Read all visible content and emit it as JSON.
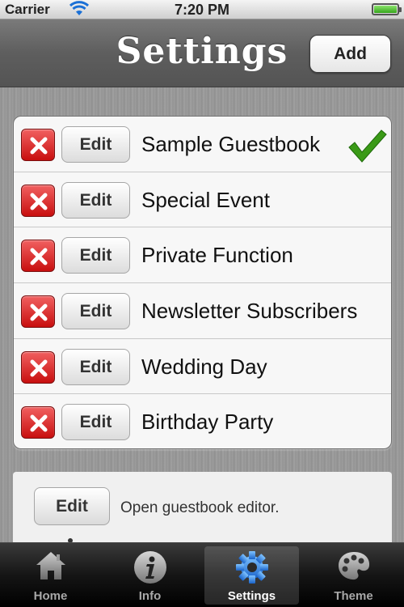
{
  "status_bar": {
    "carrier": "Carrier",
    "time": "7:20 PM"
  },
  "nav": {
    "title": "Settings",
    "add_label": "Add"
  },
  "guestbooks": [
    {
      "delete_icon": "x-icon",
      "edit_label": "Edit",
      "name": "Sample Guestbook",
      "selected": true
    },
    {
      "delete_icon": "x-icon",
      "edit_label": "Edit",
      "name": "Special Event",
      "selected": false
    },
    {
      "delete_icon": "x-icon",
      "edit_label": "Edit",
      "name": "Private Function",
      "selected": false
    },
    {
      "delete_icon": "x-icon",
      "edit_label": "Edit",
      "name": "Newsletter Subscribers",
      "selected": false
    },
    {
      "delete_icon": "x-icon",
      "edit_label": "Edit",
      "name": "Wedding Day",
      "selected": false
    },
    {
      "delete_icon": "x-icon",
      "edit_label": "Edit",
      "name": "Birthday Party",
      "selected": false
    }
  ],
  "editor_panel": {
    "edit_label": "Edit",
    "description": "Open guestbook editor."
  },
  "tabs": [
    {
      "label": "Home",
      "icon": "house-icon",
      "selected": false
    },
    {
      "label": "Info",
      "icon": "info-icon",
      "selected": false
    },
    {
      "label": "Settings",
      "icon": "gear-icon",
      "selected": true
    },
    {
      "label": "Theme",
      "icon": "palette-icon",
      "selected": false
    }
  ],
  "colors": {
    "delete_red": "#d92626",
    "check_green": "#3a9a17",
    "settings_tab_blue": "#2a7fe0"
  }
}
